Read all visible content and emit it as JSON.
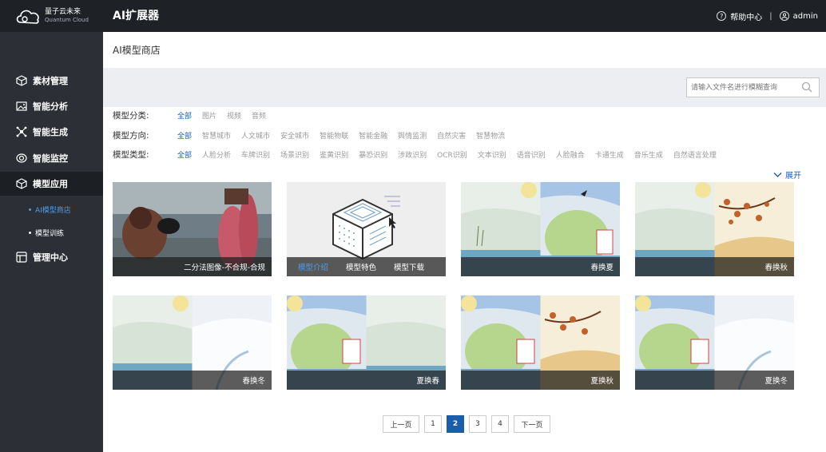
{
  "header": {
    "logo_cn": "量子云未来",
    "logo_en": "Quantum Cloud",
    "title": "AI扩展器",
    "help_label": "帮助中心",
    "separator": "|",
    "user": "admin"
  },
  "sidebar": {
    "items": [
      {
        "label": "素材管理",
        "icon": "cube-icon"
      },
      {
        "label": "智能分析",
        "icon": "image-icon"
      },
      {
        "label": "智能生成",
        "icon": "network-icon"
      },
      {
        "label": "智能监控",
        "icon": "camera-icon"
      },
      {
        "label": "模型应用",
        "icon": "box-icon"
      },
      {
        "label": "管理中心",
        "icon": "grid-icon"
      }
    ],
    "subitems": [
      {
        "label": "AI模型商店"
      },
      {
        "label": "模型训练"
      }
    ]
  },
  "main": {
    "page_title": "AI模型商店",
    "search_placeholder": "请输入文件名进行模糊查询",
    "filters": [
      {
        "label": "模型分类:",
        "options": [
          "全部",
          "图片",
          "视频",
          "音频"
        ]
      },
      {
        "label": "模型方向:",
        "options": [
          "全部",
          "智慧城市",
          "人文城市",
          "安全城市",
          "智能物联",
          "智能金融",
          "舆情监测",
          "自然灾害",
          "智慧物流"
        ]
      },
      {
        "label": "模型类型:",
        "options": [
          "全部",
          "人脸分析",
          "车牌识别",
          "场景识别",
          "鉴黄识别",
          "暴恐识别",
          "涉政识别",
          "OCR识别",
          "文本识别",
          "语音识别",
          "人脸融合",
          "卡通生成",
          "音乐生成",
          "自然语言处理"
        ]
      }
    ],
    "expand_label": "展开",
    "cards": [
      {
        "caption": "二分法图像-不合规-合规"
      },
      {
        "intro": "模型介绍",
        "feature": "模型特色",
        "download": "模型下载"
      },
      {
        "caption": "春换夏"
      },
      {
        "caption": "春换秋"
      },
      {
        "caption": "春换冬"
      },
      {
        "caption": "夏换春"
      },
      {
        "caption": "夏换秋"
      },
      {
        "caption": "夏换冬"
      }
    ],
    "pagination": {
      "prev": "上一页",
      "pages": [
        "1",
        "2",
        "3",
        "4"
      ],
      "current": "2",
      "next": "下一页"
    }
  },
  "colors": {
    "header_bg": "#1e2226",
    "sidebar_bg": "#2c3036",
    "accent": "#1a5dad",
    "sub_active": "#4d9be8"
  }
}
